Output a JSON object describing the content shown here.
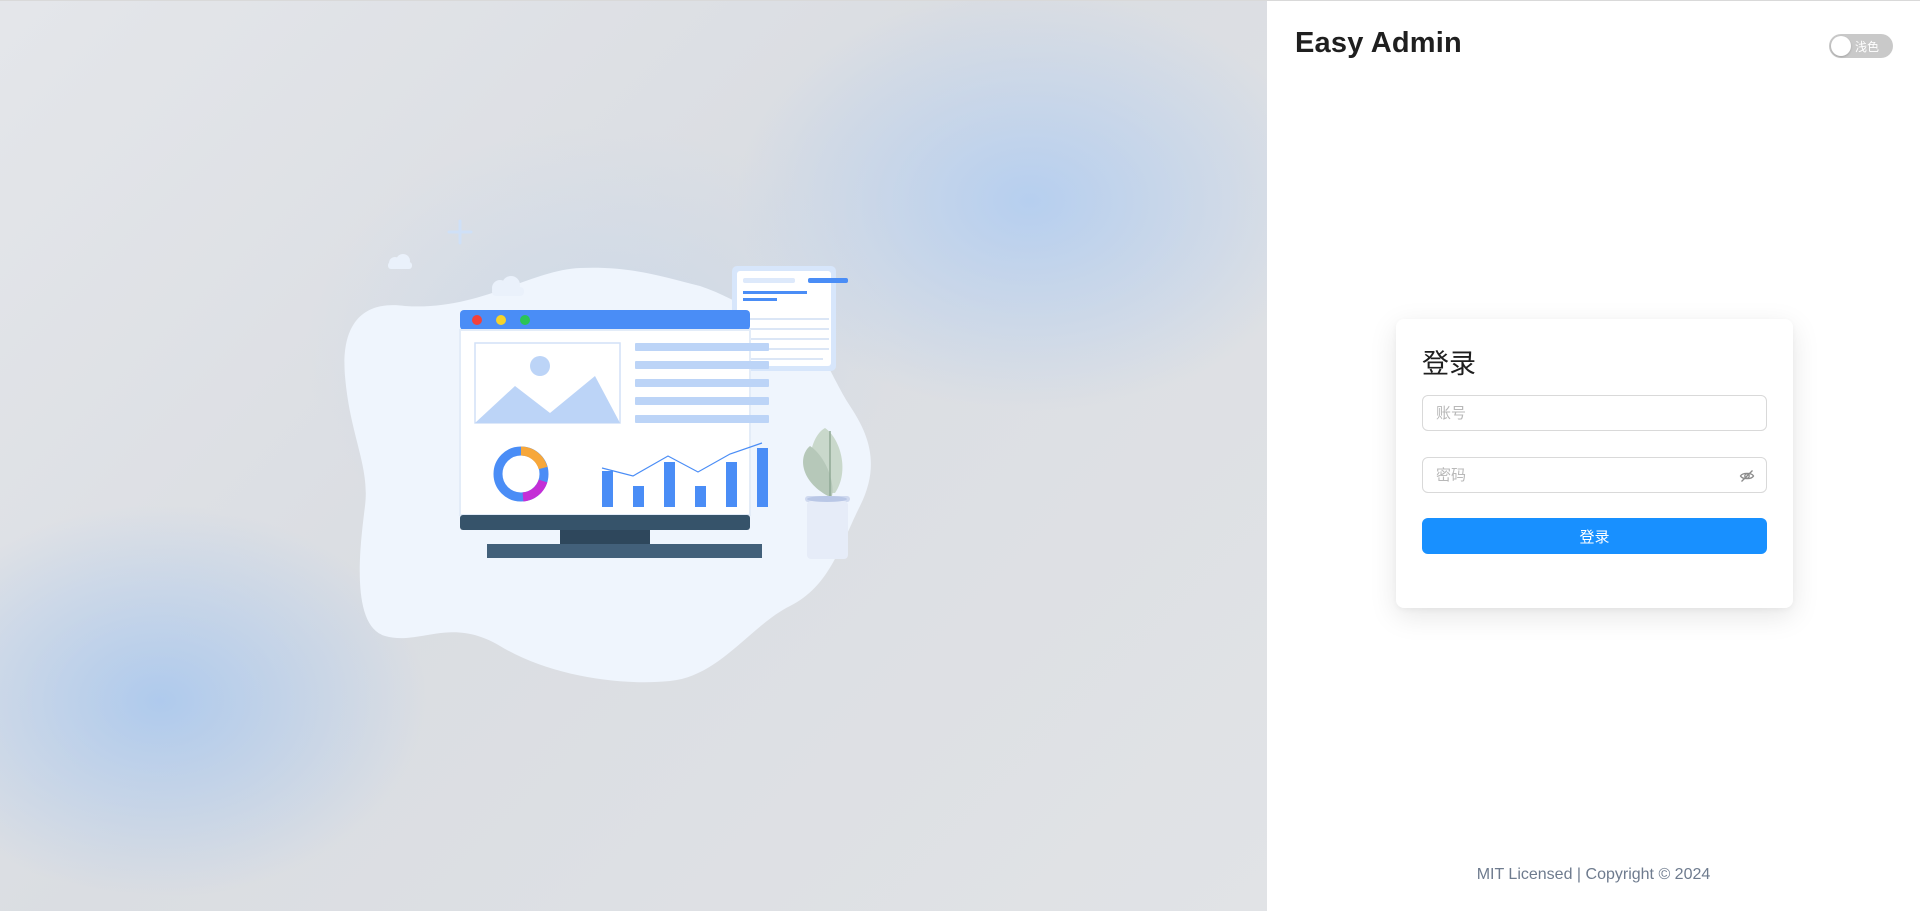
{
  "brand": {
    "title": "Easy Admin"
  },
  "theme_toggle": {
    "label": "浅色",
    "on": false
  },
  "login": {
    "title": "登录",
    "account_placeholder": "账号",
    "account_value": "",
    "password_placeholder": "密码",
    "password_value": "",
    "submit_label": "登录",
    "password_icon": "eye-invisible-icon"
  },
  "footer": {
    "text": "MIT Licensed | Copyright © 2024"
  },
  "colors": {
    "primary": "#1890ff",
    "illustration_blue": "#4a8df6",
    "illustration_dark": "#36536a"
  }
}
